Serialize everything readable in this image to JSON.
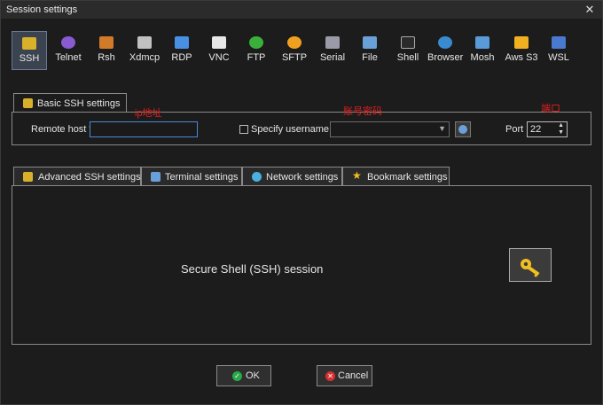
{
  "window": {
    "title": "Session settings"
  },
  "protocols": [
    {
      "label": "SSH",
      "icon": "ssh-key-icon",
      "color": "#d8b02a",
      "selected": true
    },
    {
      "label": "Telnet",
      "icon": "telnet-icon",
      "color": "#8a5ad0"
    },
    {
      "label": "Rsh",
      "icon": "rsh-icon",
      "color": "#d07a2a"
    },
    {
      "label": "Xdmcp",
      "icon": "xdmcp-icon",
      "color": "#c0c0c0"
    },
    {
      "label": "RDP",
      "icon": "rdp-icon",
      "color": "#4a90e2"
    },
    {
      "label": "VNC",
      "icon": "vnc-icon",
      "color": "#e8e8e8"
    },
    {
      "label": "FTP",
      "icon": "ftp-icon",
      "color": "#3ab03a"
    },
    {
      "label": "SFTP",
      "icon": "sftp-icon",
      "color": "#f0a020"
    },
    {
      "label": "Serial",
      "icon": "serial-icon",
      "color": "#9a9aa8"
    },
    {
      "label": "File",
      "icon": "file-icon",
      "color": "#6aa0d8"
    },
    {
      "label": "Shell",
      "icon": "shell-icon",
      "color": "#2a2a2a"
    },
    {
      "label": "Browser",
      "icon": "browser-icon",
      "color": "#3a8ad0"
    },
    {
      "label": "Mosh",
      "icon": "mosh-icon",
      "color": "#5a9ad8"
    },
    {
      "label": "Aws S3",
      "icon": "aws-s3-icon",
      "color": "#f0b020"
    },
    {
      "label": "WSL",
      "icon": "wsl-icon",
      "color": "#4a7ad0"
    }
  ],
  "basic": {
    "tab_label": "Basic SSH settings",
    "remote_host_label": "Remote host *",
    "remote_host_value": "",
    "specify_username_label": "Specify username",
    "specify_username_checked": false,
    "username_value": "",
    "port_label": "Port",
    "port_value": "22",
    "annotations": {
      "host": "ip地址",
      "account": "账号密码",
      "port": "端口"
    }
  },
  "subtabs": [
    {
      "label": "Advanced SSH settings",
      "icon": "advanced-key-icon",
      "color": "#d8b02a"
    },
    {
      "label": "Terminal settings",
      "icon": "terminal-icon",
      "color": "#6aa0d8"
    },
    {
      "label": "Network settings",
      "icon": "network-icon",
      "color": "#4ab0e0"
    },
    {
      "label": "Bookmark settings",
      "icon": "star-icon",
      "color": "#f0c020"
    }
  ],
  "panel": {
    "caption": "Secure Shell (SSH) session"
  },
  "buttons": {
    "ok_label": "OK",
    "ok_icon": "checkmark-icon",
    "cancel_label": "Cancel",
    "cancel_icon": "cancel-x-icon",
    "ok_color": "#2aa84a",
    "cancel_color": "#d83030"
  }
}
